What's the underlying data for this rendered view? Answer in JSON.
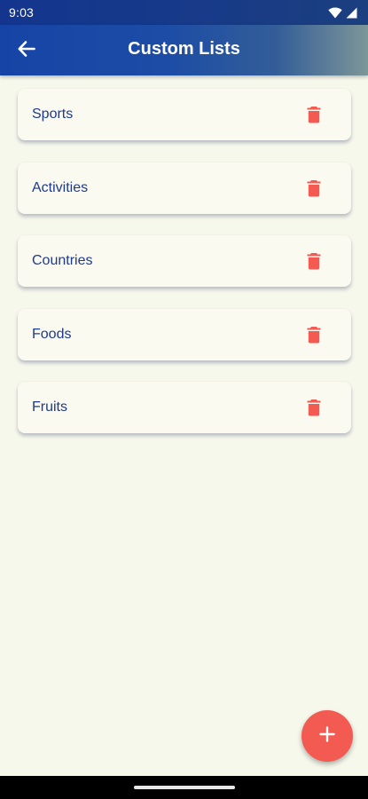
{
  "status_bar": {
    "time": "9:03",
    "icons": [
      "wifi-icon",
      "signal-icon"
    ]
  },
  "app_bar": {
    "title": "Custom Lists",
    "back_icon": "arrow-back-icon"
  },
  "lists": [
    {
      "label": "Sports"
    },
    {
      "label": "Activities"
    },
    {
      "label": "Countries"
    },
    {
      "label": "Foods"
    },
    {
      "label": "Fruits"
    }
  ],
  "fab": {
    "icon": "plus-icon"
  },
  "colors": {
    "primary": "#1644a6",
    "accent": "#f25a52",
    "background": "#f7f8ec",
    "item_text": "#1f3a8c"
  }
}
